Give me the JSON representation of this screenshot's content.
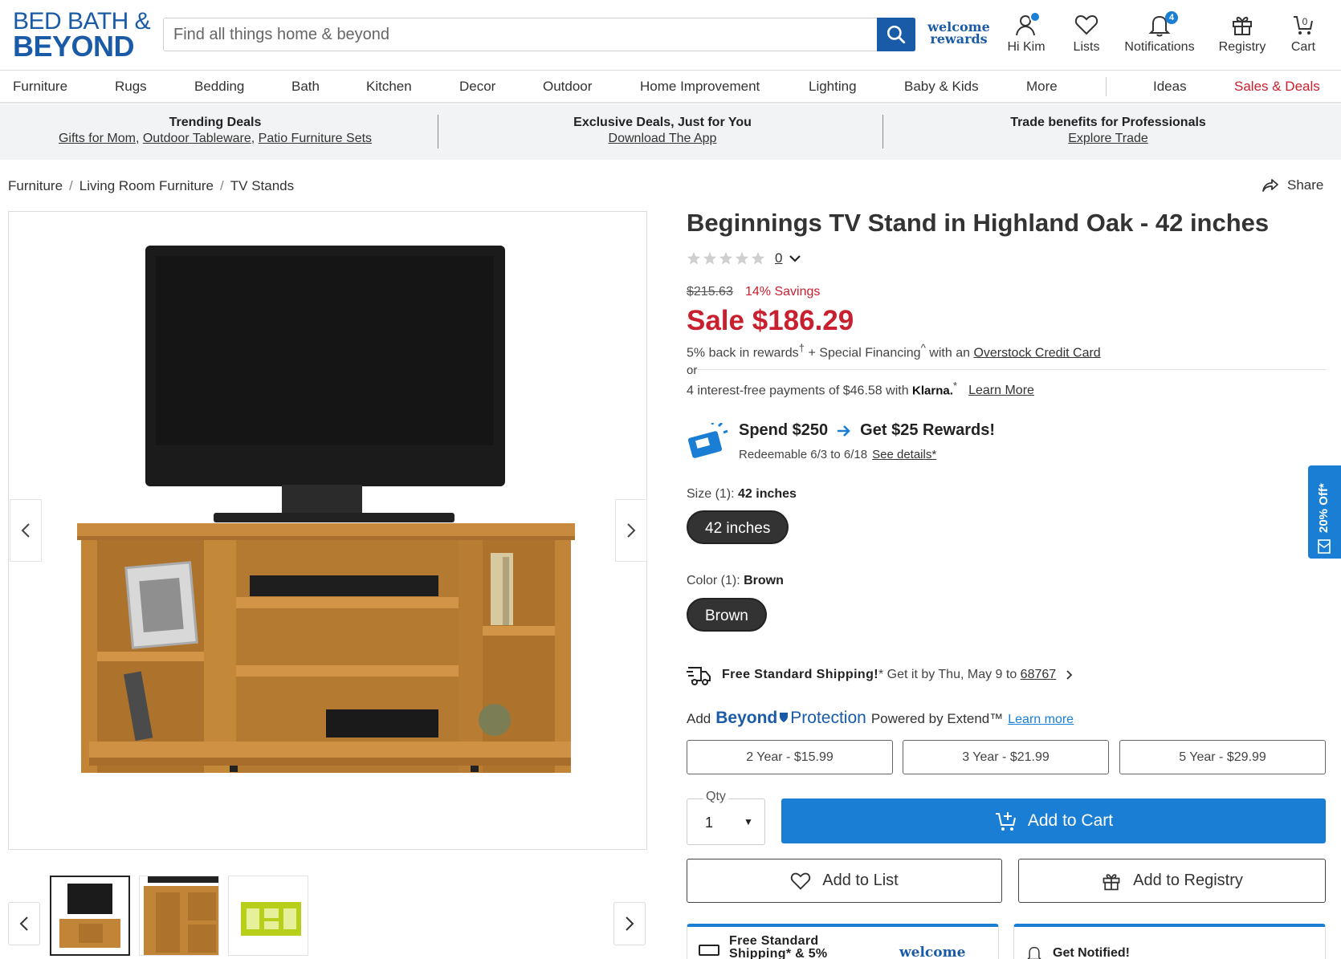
{
  "header": {
    "logo_line1": "BED BATH &",
    "logo_line2": "BEYOND",
    "search_placeholder": "Find all things home & beyond",
    "rewards_line1": "welcome",
    "rewards_line2": "rewards",
    "account_label": "Hi Kim",
    "lists_label": "Lists",
    "notifications_label": "Notifications",
    "notifications_count": "4",
    "registry_label": "Registry",
    "cart_label": "Cart",
    "cart_count": "0"
  },
  "nav": {
    "items": [
      "Furniture",
      "Rugs",
      "Bedding",
      "Bath",
      "Kitchen",
      "Decor",
      "Outdoor",
      "Home Improvement",
      "Lighting",
      "Baby & Kids",
      "More"
    ],
    "ideas": "Ideas",
    "sales": "Sales & Deals"
  },
  "promo": {
    "col1_title": "Trending Deals",
    "col1_links": [
      "Gifts for Mom",
      "Outdoor Tableware",
      "Patio Furniture Sets"
    ],
    "col2_title": "Exclusive Deals, Just for You",
    "col2_link": "Download The App",
    "col3_title": "Trade benefits for Professionals",
    "col3_link": "Explore Trade"
  },
  "breadcrumb": [
    "Furniture",
    "Living Room Furniture",
    "TV Stands"
  ],
  "share_label": "Share",
  "product": {
    "title": "Beginnings TV Stand in Highland Oak - 42 inches",
    "rating_count": "0",
    "rating_stars": 0,
    "original_price": "$215.63",
    "savings": "14% Savings",
    "sale_price": "Sale $186.29",
    "rewards_text": "5% back in rewards",
    "rewards_sup": "†",
    "financing_text": " + Special Financing",
    "financing_sup": "^",
    "with_an": " with an ",
    "credit_card_link": "Overstock Credit Card",
    "or": "or",
    "klarna_text": "4 interest-free payments of $46.58 with ",
    "klarna_brand": "Klarna.",
    "klarna_sup": "*",
    "learn_more": "Learn More"
  },
  "rewards_promo": {
    "spend": "Spend $250",
    "get": "Get $25 Rewards!",
    "redeem": "Redeemable 6/3 to 6/18",
    "details_link": "See details*"
  },
  "options": {
    "size_label": "Size (1): ",
    "size_value": "42 inches",
    "size_pill": "42 inches",
    "color_label": "Color (1): ",
    "color_value": "Brown",
    "color_pill": "Brown"
  },
  "shipping": {
    "bold": "Free Standard Shipping!",
    "rest": "* Get it by Thu, May 9 to ",
    "zip": "68767"
  },
  "protection": {
    "add": "Add",
    "beyond": "Beyond",
    "protection": "Protection",
    "powered": "Powered by Extend™",
    "learn_more": "Learn more",
    "plans": [
      "2 Year - $15.99",
      "3 Year - $21.99",
      "5 Year - $29.99"
    ]
  },
  "purchase": {
    "qty_label": "Qty",
    "qty_value": "1",
    "add_to_cart": "Add to Cart",
    "add_to_list": "Add to List",
    "add_to_registry": "Add to Registry"
  },
  "cards": {
    "card1_text": "Free Standard Shipping* & 5%",
    "card1_brand": "welcome",
    "card2_text": "Get Notified!"
  },
  "side_tab": "20% Off*",
  "colors": {
    "brand_blue": "#1a5ba8",
    "action_blue": "#1a7fd4",
    "sale_red": "#c8202f"
  }
}
